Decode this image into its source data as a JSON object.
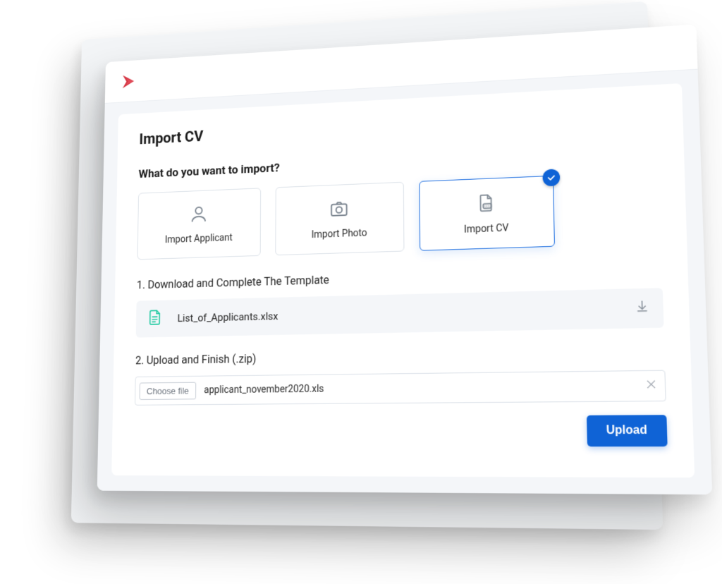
{
  "panel": {
    "title": "Import CV",
    "subtitle": "What do you want to import?"
  },
  "options": {
    "applicant": "Import Applicant",
    "photo": "Import Photo",
    "cv": "Import CV"
  },
  "step1": {
    "label": "1. Download and Complete The Template",
    "filename": "List_of_Applicants.xlsx"
  },
  "step2": {
    "label": "2. Upload and Finish (.zip)",
    "choose_label": "Choose file",
    "chosen_file": "applicant_november2020.xls"
  },
  "actions": {
    "upload_label": "Upload"
  }
}
